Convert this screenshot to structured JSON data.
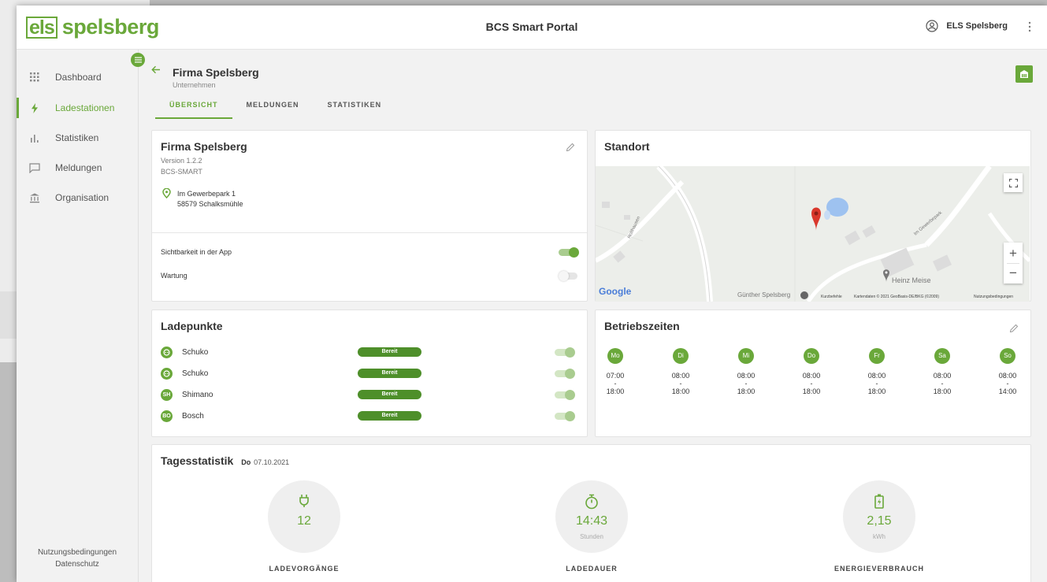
{
  "header": {
    "logo_left": "els",
    "logo_right": "spelsberg",
    "title": "BCS Smart Portal",
    "user": "ELS Spelsberg"
  },
  "sidebar": {
    "items": [
      {
        "label": "Dashboard",
        "icon": "grid-icon"
      },
      {
        "label": "Ladestationen",
        "icon": "bolt-icon",
        "active": true
      },
      {
        "label": "Statistiken",
        "icon": "bar-chart-icon"
      },
      {
        "label": "Meldungen",
        "icon": "message-icon"
      },
      {
        "label": "Organisation",
        "icon": "bank-icon"
      }
    ],
    "footer": {
      "terms": "Nutzungsbedingungen",
      "privacy": "Datenschutz"
    }
  },
  "page": {
    "title": "Firma Spelsberg",
    "subtitle": "Unternehmen",
    "tabs": [
      "ÜBERSICHT",
      "MELDUNGEN",
      "STATISTIKEN"
    ],
    "active_tab": "ÜBERSICHT"
  },
  "station": {
    "title": "Firma Spelsberg",
    "version": "Version 1.2.2",
    "type": "BCS-SMART",
    "street": "Im Gewerbepark 1",
    "city": "58579 Schalksmühle",
    "visibility_label": "Sichtbarkeit in der App",
    "visibility_on": true,
    "maintenance_label": "Wartung",
    "maintenance_on": false
  },
  "location": {
    "title": "Standort",
    "google": "Google",
    "poi_1": "Heinz Meise",
    "poi_2": "Günther Spelsberg",
    "street_label_1": "Im Gewerbepark",
    "street_label_2": "Holthausen",
    "attrib_shortcuts": "Kurzbefehle",
    "attrib_data": "Kartendaten © 2021 GeoBasis-DE/BKG (©2009)",
    "attrib_terms": "Nutzungsbedingungen"
  },
  "chargepoints": {
    "title": "Ladepunkte",
    "items": [
      {
        "icon_text": "",
        "name": "Schuko",
        "status": "Bereit"
      },
      {
        "icon_text": "",
        "name": "Schuko",
        "status": "Bereit"
      },
      {
        "icon_text": "SH",
        "name": "Shimano",
        "status": "Bereit"
      },
      {
        "icon_text": "BO",
        "name": "Bosch",
        "status": "Bereit"
      }
    ]
  },
  "hours": {
    "title": "Betriebszeiten",
    "days": [
      {
        "day": "Mo",
        "open": "07:00",
        "sep": "-",
        "close": "18:00"
      },
      {
        "day": "Di",
        "open": "08:00",
        "sep": "-",
        "close": "18:00"
      },
      {
        "day": "Mi",
        "open": "08:00",
        "sep": "-",
        "close": "18:00"
      },
      {
        "day": "Do",
        "open": "08:00",
        "sep": "-",
        "close": "18:00"
      },
      {
        "day": "Fr",
        "open": "08:00",
        "sep": "-",
        "close": "18:00"
      },
      {
        "day": "Sa",
        "open": "08:00",
        "sep": "-",
        "close": "18:00"
      },
      {
        "day": "So",
        "open": "08:00",
        "sep": "-",
        "close": "14:00"
      }
    ]
  },
  "daily": {
    "title": "Tagesstatistik",
    "weekday": "Do",
    "date": "07.10.2021",
    "stats": [
      {
        "value": "12",
        "unit": "",
        "label": "LADEVORGÄNGE",
        "icon": "plug-icon"
      },
      {
        "value": "14:43",
        "unit": "Stunden",
        "label": "LADEDAUER",
        "icon": "stopwatch-icon"
      },
      {
        "value": "2,15",
        "unit": "kWh",
        "label": "ENERGIEVERBRAUCH",
        "icon": "battery-charging-icon"
      }
    ]
  },
  "colors": {
    "accent": "#6aa83a",
    "badge": "#4e8f2a"
  }
}
